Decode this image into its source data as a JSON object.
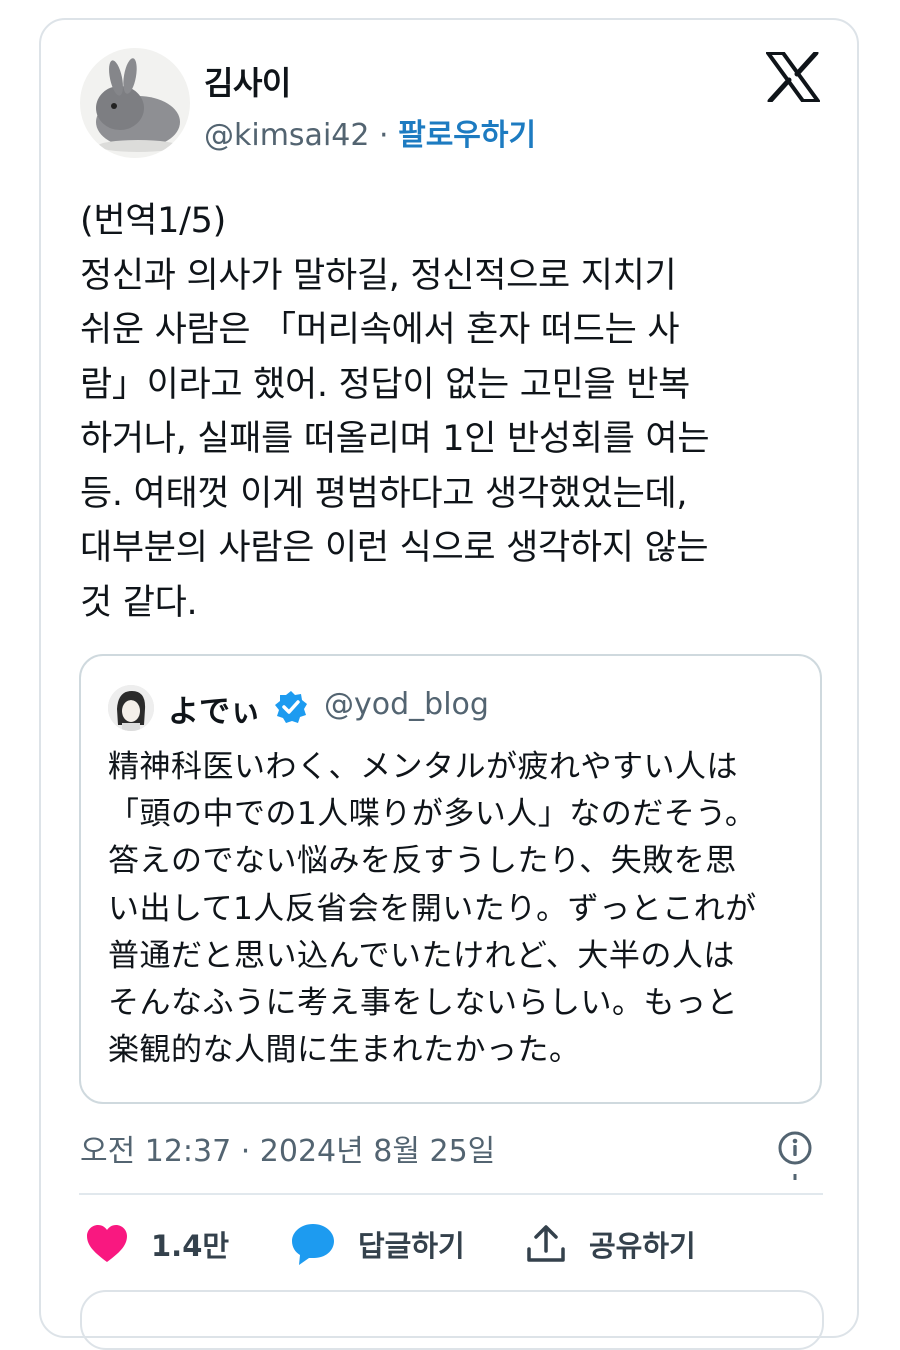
{
  "author": {
    "display_name": "김사이",
    "handle": "@kimsai42",
    "separator": "·",
    "follow_label": "팔로우하기"
  },
  "tweet": {
    "lines": [
      "(번역1/5)",
      "정신과 의사가 말하길, 정신적으로 지치기",
      "쉬운 사람은 「머리속에서 혼자 떠드는 사",
      "람」이라고 했어. 정답이 없는 고민을 반복",
      "하거나, 실패를 떠올리며 1인 반성회를 여는",
      "등. 여태껏 이게 평범하다고 생각했었는데,",
      "대부분의 사람은 이런 식으로 생각하지 않는",
      "것 같다."
    ]
  },
  "quote": {
    "display_name": "よでぃ",
    "handle": "@yod_blog",
    "verified_icon": "verified-badge-icon",
    "lines": [
      "精神科医いわく、メンタルが疲れやすい人は",
      "「頭の中での1人喋りが多い人」なのだそう。",
      "答えのでない悩みを反すうしたり、失敗を思",
      "い出して1人反省会を開いたり。ずっとこれが",
      "普通だと思い込んでいたけれど、大半の人は",
      "そんなふうに考え事をしないらしい。もっと",
      "楽観的な人間に生まれたかった。"
    ]
  },
  "timestamp": "오전 12:37 · 2024년 8월 25일",
  "actions": {
    "like_count": "1.4만",
    "reply_label": "답글하기",
    "share_label": "공유하기"
  },
  "colors": {
    "accent": "#1d9bf0",
    "follow": "#1d7bc1",
    "like": "#f91880",
    "secondary_text": "#536471",
    "border": "#cfd9de"
  },
  "icons": [
    "x-logo-icon",
    "info-icon",
    "heart-icon",
    "speech-bubble-icon",
    "share-icon"
  ]
}
